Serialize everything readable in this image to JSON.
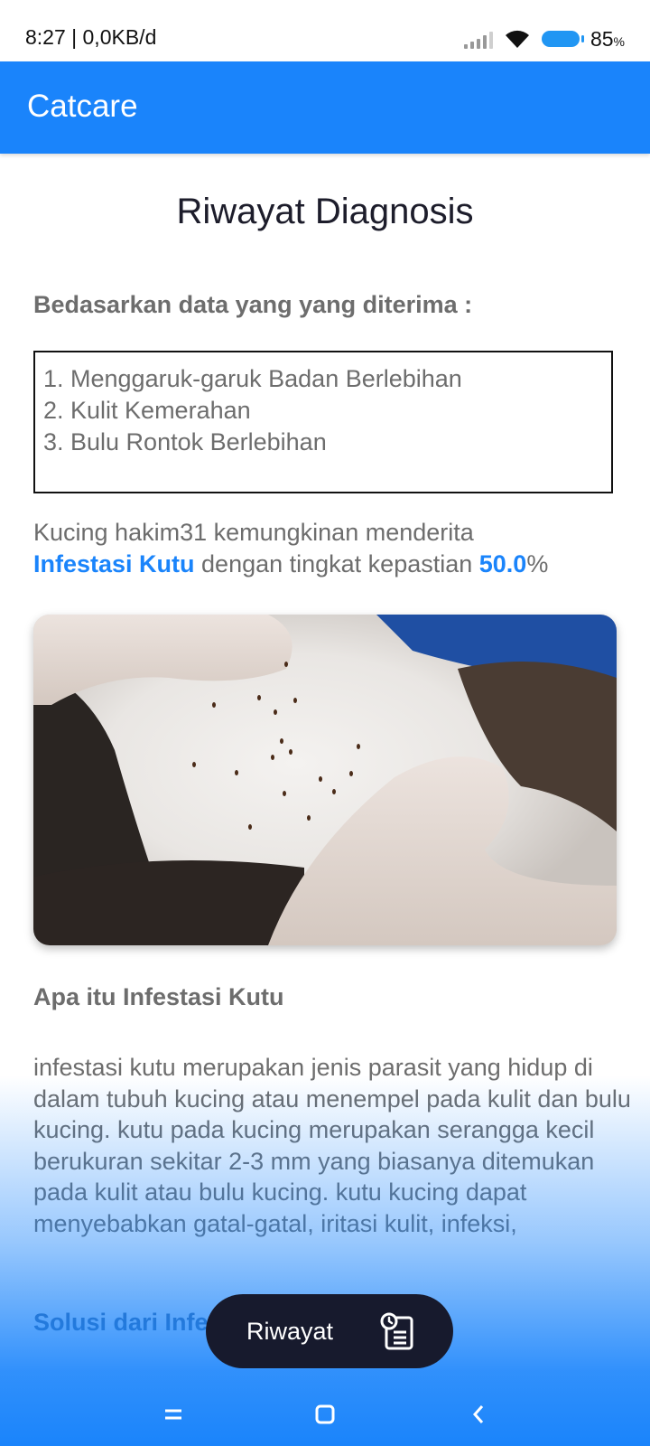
{
  "status_bar": {
    "time": "8:27 | 0,0KB/d",
    "battery": "85",
    "battery_unit": "%"
  },
  "app_bar": {
    "title": "Catcare"
  },
  "page": {
    "heading": "Riwayat Diagnosis",
    "based_on": "Bedasarkan data yang yang diterima :",
    "symptoms": [
      "1. Menggaruk-garuk Badan Berlebihan",
      "2. Kulit Kemerahan",
      "3. Bulu Rontok Berlebihan"
    ],
    "result": {
      "prefix": "Kucing hakim31 kemungkinan menderita",
      "disease": "Infestasi Kutu",
      "middle": " dengan tingkat kepastian ",
      "certainty": "50.0",
      "suffix": "%"
    },
    "section_title": "Apa itu Infestasi Kutu",
    "description": "infestasi kutu merupakan jenis parasit yang hidup di dalam tubuh kucing atau menempel pada kulit dan bulu kucing. kutu pada kucing merupakan serangga kecil berukuran sekitar 2-3 mm yang biasanya ditemukan pada kulit atau bulu kucing. kutu kucing dapat menyebabkan gatal-gatal, iritasi kulit, infeksi,",
    "solution_title": "Solusi dari Infe"
  },
  "fab": {
    "label": "Riwayat",
    "icon": "history-clipboard-icon"
  },
  "nav": {
    "menu_icon": "menu-icon",
    "home_icon": "home-icon",
    "back_icon": "back-icon"
  },
  "colors": {
    "primary": "#1a84fb",
    "fab": "#171a2d",
    "text_gray": "#6d6d6d"
  }
}
